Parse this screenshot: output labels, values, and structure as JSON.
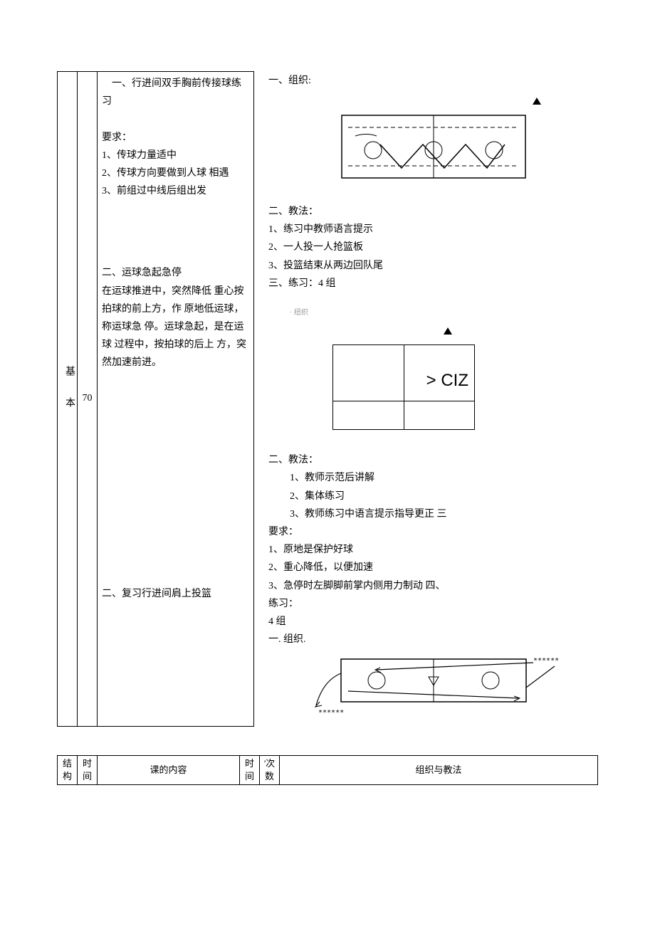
{
  "col_struct_label": "基本",
  "col_time_value": "70",
  "content": {
    "block1": {
      "title": "　一、行进间双手胸前传接球练习",
      "req_label": "要求：",
      "items": [
        "1、传球力量适中",
        "2、传球方向要做到人球 相遇",
        "3、前组过中线后组出发"
      ]
    },
    "block2": {
      "title": "二、运球急起急停",
      "body": "在运球推进中，突然降低 重心按拍球的前上方，作 原地低运球，称运球急 停。运球急起，是在运球 过程中，按拍球的后上 方，突然加速前进。"
    },
    "block3": {
      "title": "二、复习行进间肩上投篮"
    }
  },
  "right": {
    "sec1": {
      "org_label": "一、组织:",
      "teach_label": "二、教法：",
      "teach_items": [
        "1、练习中教师语言提示",
        "2、一人投一人抢篮板",
        "3、投篮结束从两边回队尾"
      ],
      "practice_label": "三、练习：4 组"
    },
    "sec2": {
      "org_label_faded": "· 纽织",
      "teach_label": "二、教法：",
      "teach_items": [
        "1、教师示范后讲解",
        "2、集体练习",
        "3、教师练习中语言提示指导更正 三"
      ],
      "req_label": "要求：",
      "req_items": [
        "1、原地是保护好球",
        "2、重心降低，以便加速",
        "3、急停时左脚脚前掌内侧用力制动 四、"
      ],
      "practice_label": "练习：",
      "practice_val": "4 组",
      "org_label2": "一. 组织."
    },
    "diag2_text": "> CIZ",
    "diag3_stars": "******"
  },
  "header2": {
    "c1": "结构",
    "c2": "时间",
    "c3": "课的内容",
    "c4": "时间",
    "c5": "'次数",
    "c6": "组织与教法"
  }
}
